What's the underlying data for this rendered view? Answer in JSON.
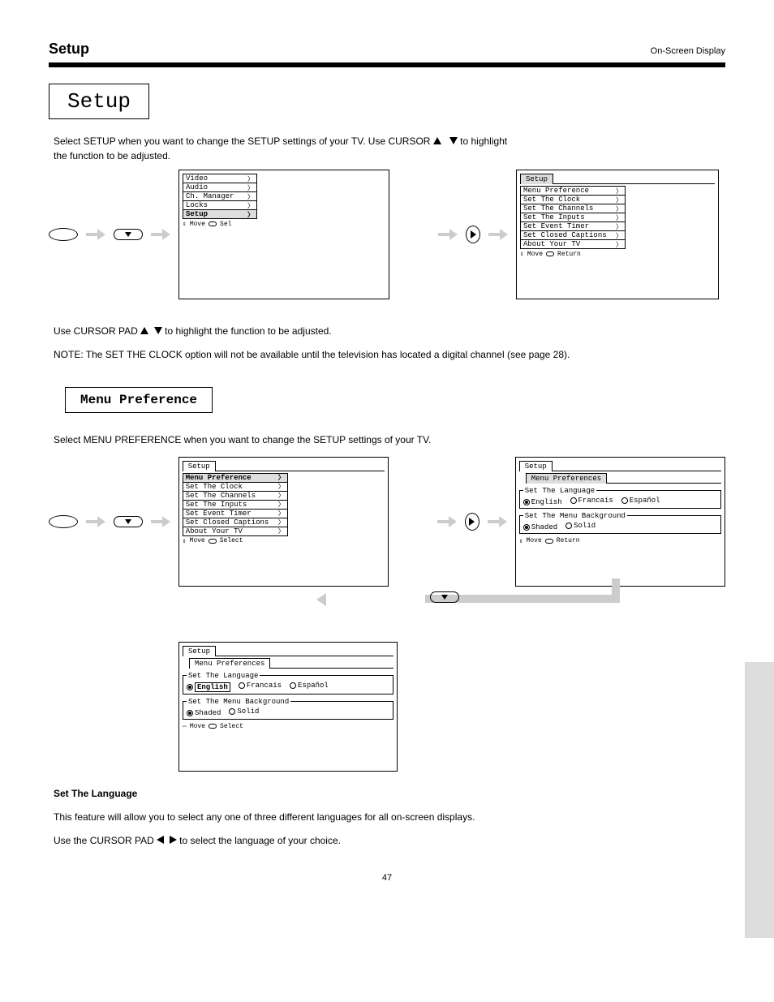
{
  "header": {
    "title": "Setup",
    "page_label": "On-Screen Display"
  },
  "setup_title": "Setup",
  "intro": {
    "line1_pre": "Select SETUP when you want to change the SETUP settings of your TV. Use CURSOR ",
    "line1_post": " to highlight",
    "line2": "the function to be adjusted."
  },
  "main_menu": {
    "items": [
      "Video",
      "Audio",
      "Ch. Manager",
      "Locks",
      "Setup"
    ],
    "hint_move": "Move",
    "hint_sel": "Sel"
  },
  "setup_menu": {
    "tab": "Setup",
    "items": [
      "Menu Preference",
      "Set The Clock",
      "Set The Channels",
      "Set The Inputs",
      "Set Event Timer",
      "Set Closed Captions",
      "About Your TV"
    ],
    "hint_move": "Move",
    "hint_return": "Return",
    "hint_select": "Select"
  },
  "step2": {
    "pre": "Use CURSOR PAD ",
    "post": " to highlight the function to be adjusted."
  },
  "note": "NOTE: The SET THE CLOCK option will not be available until the television has located a digital channel (see page 28).",
  "sub_title": "Menu Preference",
  "sub_desc": "Select MENU PREFERENCE when you want to change the SETUP settings of your TV.",
  "pref_screen": {
    "setup_tab": "Setup",
    "pref_tab": "Menu Preferences",
    "lang_legend": "Set The Language",
    "lang_opts": [
      "English",
      "Francais",
      "Español"
    ],
    "bg_legend": "Set The Menu Background",
    "bg_opts": [
      "Shaded",
      "Solid"
    ],
    "hint_move": "Move",
    "hint_return": "Return",
    "hint_select": "Select"
  },
  "lang_section": {
    "title": "Set The Language",
    "p1": "This feature will allow you to select any one of three different languages for all on-screen displays.",
    "p2_pre": "Use the CURSOR PAD ",
    "p2_post": " to select the language of your choice."
  },
  "footer": "47"
}
